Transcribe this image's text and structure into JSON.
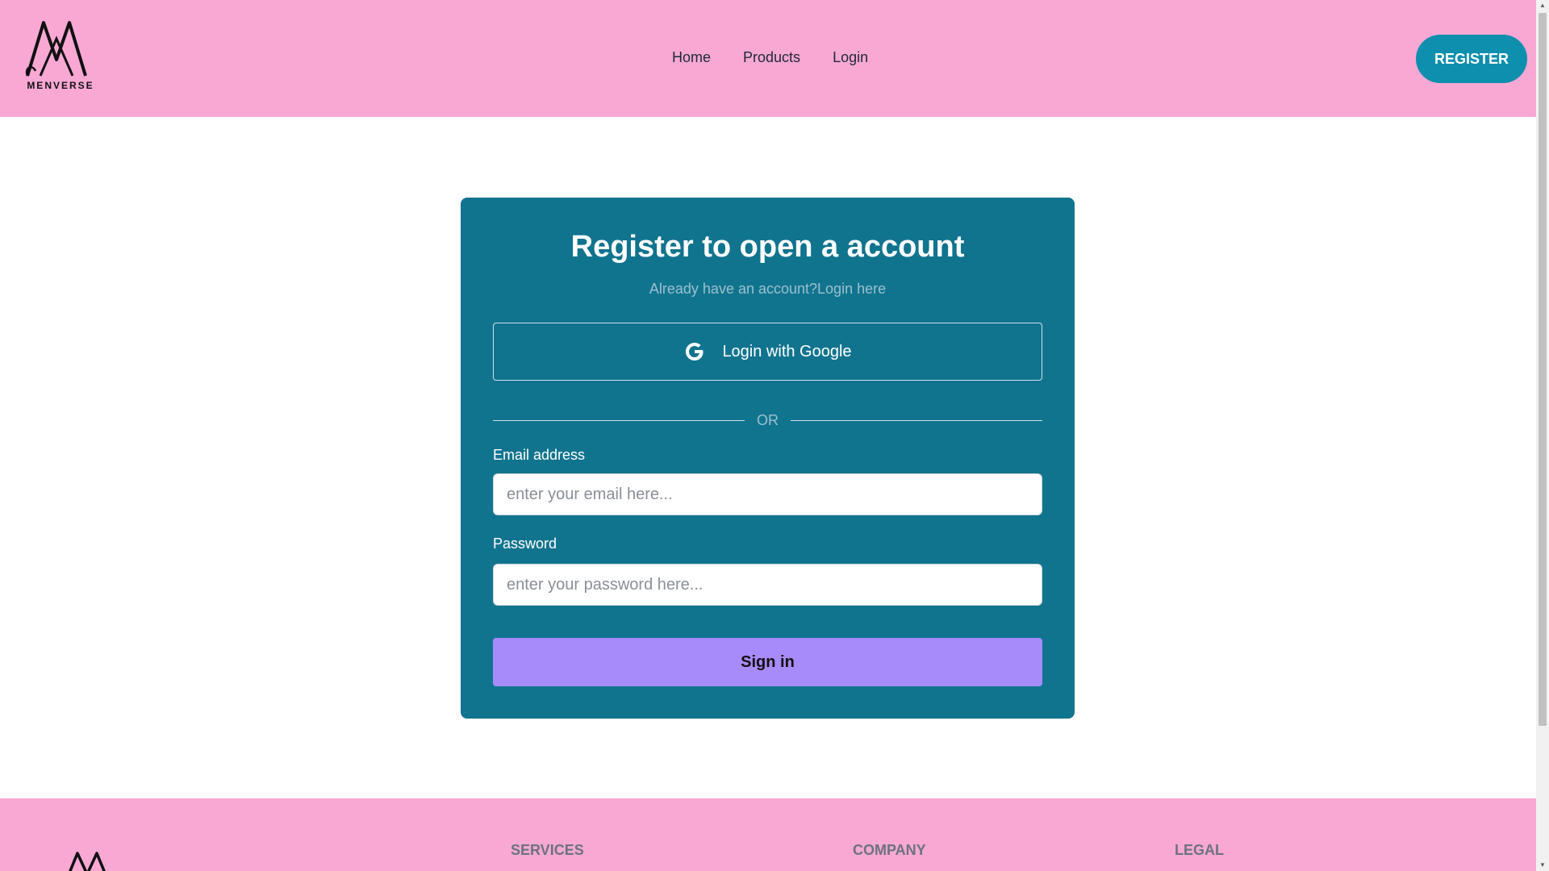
{
  "header": {
    "logo_text": "MENVERSE",
    "nav": [
      "Home",
      "Products",
      "Login"
    ],
    "register_label": "REGISTER"
  },
  "card": {
    "title": "Register to open a account",
    "subtitle": "Already have an account?Login here",
    "google_label": "Login with Google",
    "divider_text": "OR",
    "email_label": "Email address",
    "email_placeholder": "enter your email here...",
    "password_label": "Password",
    "password_placeholder": "enter your password here...",
    "signin_label": "Sign in"
  },
  "footer": {
    "headings": [
      "SERVICES",
      "COMPANY",
      "LEGAL"
    ]
  },
  "colors": {
    "header_bg": "#f9a8d4",
    "card_bg": "#11748f",
    "register_btn": "#0e8fae",
    "signin_btn": "#a78bfa"
  }
}
